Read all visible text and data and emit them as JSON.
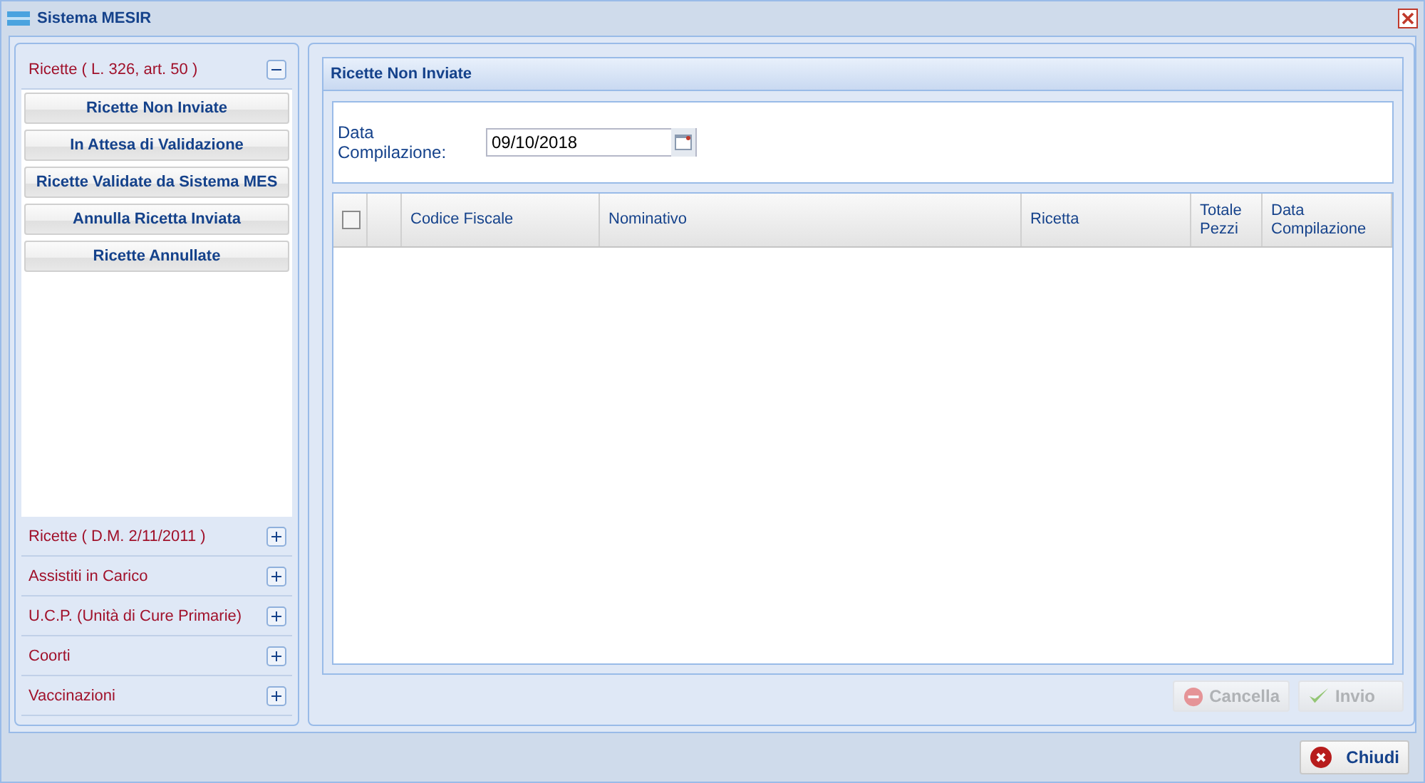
{
  "window": {
    "title": "Sistema MESIR"
  },
  "sidebar": {
    "sections": [
      {
        "label": "Ricette ( L. 326, art. 50 )",
        "expanded": true,
        "items": [
          "Ricette Non Inviate",
          "In Attesa di Validazione",
          "Ricette Validate da Sistema MES",
          "Annulla Ricetta Inviata",
          "Ricette Annullate"
        ]
      },
      {
        "label": "Ricette ( D.M. 2/11/2011 )",
        "expanded": false
      },
      {
        "label": "Assistiti in Carico",
        "expanded": false
      },
      {
        "label": "U.C.P. (Unità di Cure Primarie)",
        "expanded": false
      },
      {
        "label": "Coorti",
        "expanded": false
      },
      {
        "label": "Vaccinazioni",
        "expanded": false
      }
    ]
  },
  "panel": {
    "title": "Ricette Non Inviate",
    "form": {
      "label": "Data Compilazione:",
      "value": "09/10/2018"
    },
    "table": {
      "select_all": {
        "checked": false
      },
      "columns": [
        {
          "label": "Codice Fiscale"
        },
        {
          "label": "Nominativo"
        },
        {
          "label": "Ricetta"
        },
        {
          "label": "Totale Pezzi"
        },
        {
          "label": "Data Compilazione"
        }
      ]
    },
    "buttons": [
      {
        "label": "Cancella",
        "kind": "cancel",
        "disabled": true
      },
      {
        "label": "Invio",
        "kind": "send",
        "disabled": true
      }
    ]
  },
  "footer": {
    "buttons": [
      {
        "label": "Chiudi",
        "kind": "close",
        "disabled": false
      }
    ]
  }
}
